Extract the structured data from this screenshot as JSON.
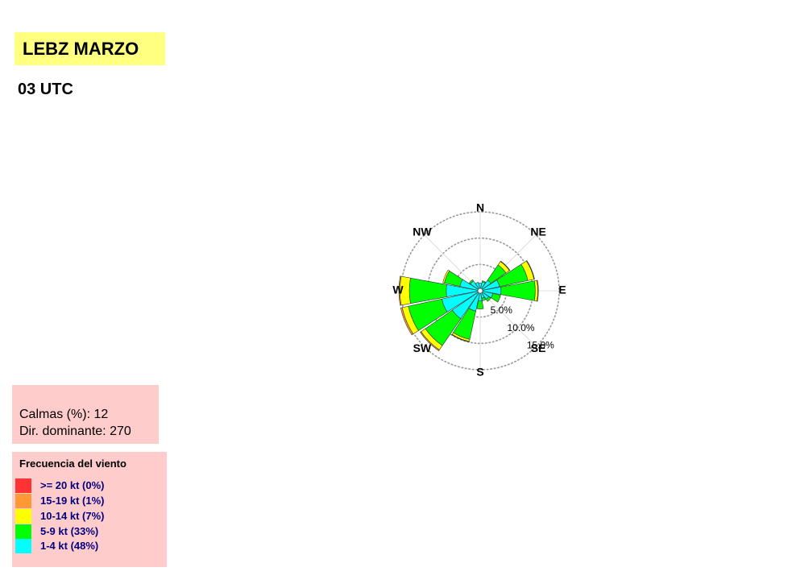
{
  "header": {
    "title": "LEBZ MARZO",
    "subtitle": "03 UTC"
  },
  "info": {
    "calmas_label": "Calmas (%):",
    "calmas_value": "12",
    "dominante_label": "Dir. dominante:",
    "dominante_value": "270"
  },
  "legend": {
    "title": "Frecuencia del viento",
    "items": [
      {
        "label": ">= 20 kt (0%)",
        "color": "#ff3333"
      },
      {
        "label": "15-19 kt (1%)",
        "color": "#ff9933"
      },
      {
        "label": "10-14 kt (7%)",
        "color": "#ffff00"
      },
      {
        "label": "5-9 kt (33%)",
        "color": "#00ff00"
      },
      {
        "label": "1-4 kt (48%)",
        "color": "#00ffff"
      }
    ]
  },
  "colors": {
    "title_bg": "#ffff80",
    "box_bg": "#ffcccc",
    "legend_text": "#000080",
    "grid": "#999999"
  },
  "chart_data": {
    "type": "wind_rose",
    "units": "percent frequency",
    "direction_labels": [
      "N",
      "NE",
      "E",
      "SE",
      "S",
      "SW",
      "W",
      "NW"
    ],
    "ring_labels": [
      "5.0%",
      "10.0%",
      "15.0%"
    ],
    "rings": [
      5,
      10,
      15
    ],
    "sectors_deg": [
      0,
      22.5,
      45,
      67.5,
      90,
      112.5,
      135,
      157.5,
      180,
      202.5,
      225,
      247.5,
      270,
      292.5,
      315,
      337.5
    ],
    "series": [
      {
        "name": "1-4 kt",
        "color": "#00ffff",
        "values": [
          1.0,
          1.3,
          2.0,
          3.3,
          3.5,
          2.0,
          1.5,
          1.0,
          1.5,
          3.5,
          6.0,
          7.0,
          6.0,
          3.5,
          1.8,
          1.2
        ]
      },
      {
        "name": "5-9 kt",
        "color": "#00ff00",
        "values": [
          0.0,
          0.2,
          3.5,
          5.5,
          6.5,
          1.5,
          0.5,
          0.5,
          1.5,
          5.5,
          6.2,
          6.5,
          7.0,
          3.0,
          0.3,
          0.0
        ]
      },
      {
        "name": "10-14 kt",
        "color": "#ffff00",
        "values": [
          0.0,
          0.0,
          0.8,
          1.2,
          0.5,
          0.0,
          0.0,
          0.0,
          0.0,
          0.4,
          1.0,
          1.2,
          1.8,
          0.3,
          0.0,
          0.0
        ]
      },
      {
        "name": "15-19 kt",
        "color": "#ff9933",
        "values": [
          0.0,
          0.0,
          0.1,
          0.1,
          0.1,
          0.0,
          0.0,
          0.0,
          0.0,
          0.1,
          0.2,
          0.3,
          0.2,
          0.0,
          0.0,
          0.0
        ]
      },
      {
        "name": ">= 20 kt",
        "color": "#ff3333",
        "values": [
          0,
          0,
          0,
          0,
          0,
          0,
          0,
          0,
          0,
          0,
          0,
          0,
          0,
          0,
          0,
          0
        ]
      }
    ]
  }
}
